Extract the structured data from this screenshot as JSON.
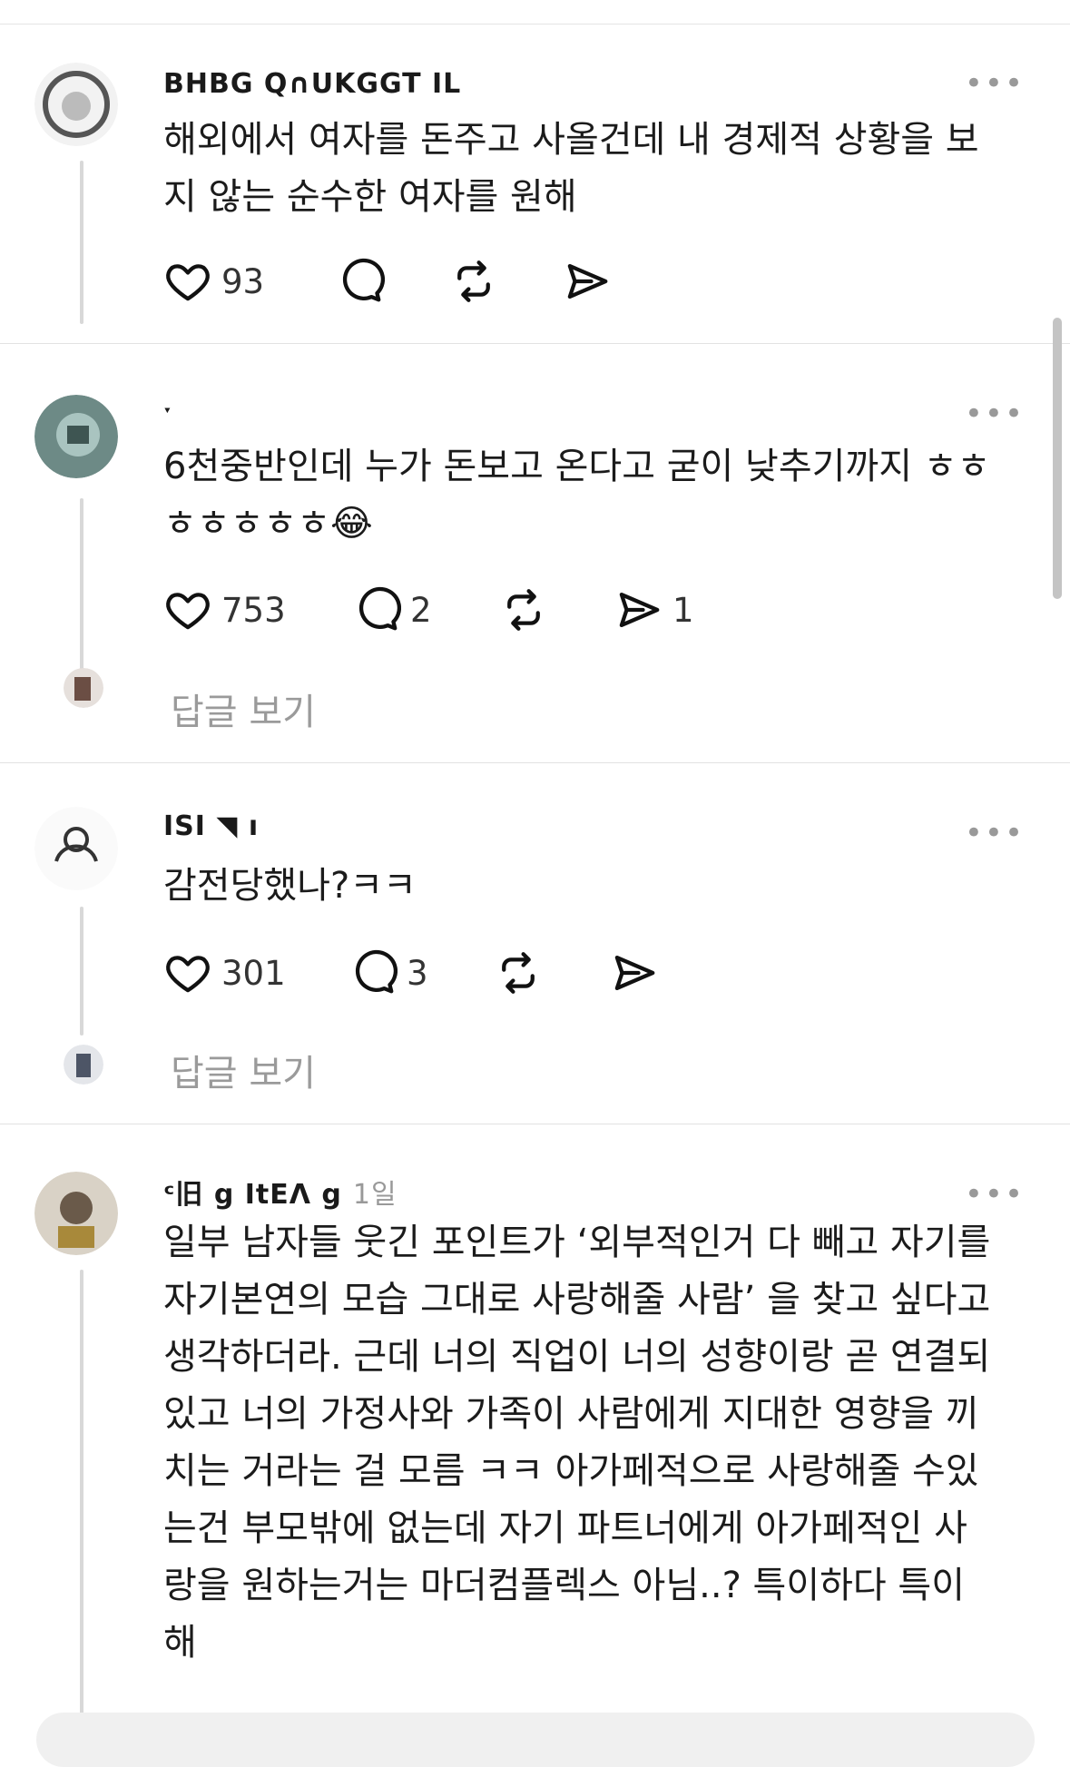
{
  "threads": [
    {
      "username": "BHBG Q∩UKGGT IL",
      "time": "",
      "body": "해외에서 여자를 돈주고 사올건데 내 경제적 상황을 보\n지 않는 순수한 여자를 원해",
      "likes": "93",
      "replies": "",
      "reposts": "",
      "shares": "",
      "view_replies": ""
    },
    {
      "username": "ˑ",
      "time": "",
      "body": "6천중반인데 누가 돈보고 온다고 굳이 낮추기까지 ㅎㅎ\nㅎㅎㅎㅎㅎ😂",
      "likes": "753",
      "replies": "2",
      "reposts": "",
      "shares": "1",
      "view_replies": "답글 보기"
    },
    {
      "username": "ISI  ◥ ı",
      "time": "",
      "body": "감전당했나?ㅋㅋ",
      "likes": "301",
      "replies": "3",
      "reposts": "",
      "shares": "",
      "view_replies": "답글 보기"
    },
    {
      "username": "ᶜ旧 g ItEᐱ g",
      "time": "1일",
      "body": "일부 남자들 웃긴 포인트가 ‘외부적인거 다 빼고 자기를\n자기본연의 모습 그대로 사랑해줄 사람’ 을 찾고 싶다고\n생각하더라. 근데 너의 직업이 너의 성향이랑 곧 연결되\n있고 너의 가정사와 가족이 사람에게 지대한 영향을 끼\n치는 거라는 걸 모름 ㅋㅋ 아가페적으로 사랑해줄 수있\n는건 부모밖에 없는데 자기 파트너에게 아가페적인 사\n랑을 원하는거는 마더컴플렉스 아님..? 특이하다 특이\n해",
      "likes": "",
      "replies": "",
      "reposts": "",
      "shares": "",
      "view_replies": ""
    }
  ],
  "icons": {
    "like": "heart-icon",
    "reply": "speech-bubble-icon",
    "repost": "repost-arrows-icon",
    "share": "paper-plane-icon",
    "more": "more-dots-icon"
  },
  "ui": {
    "more_glyph": "•••",
    "accent_text": "#1b1b1b",
    "muted_text": "#9a9a9a"
  }
}
